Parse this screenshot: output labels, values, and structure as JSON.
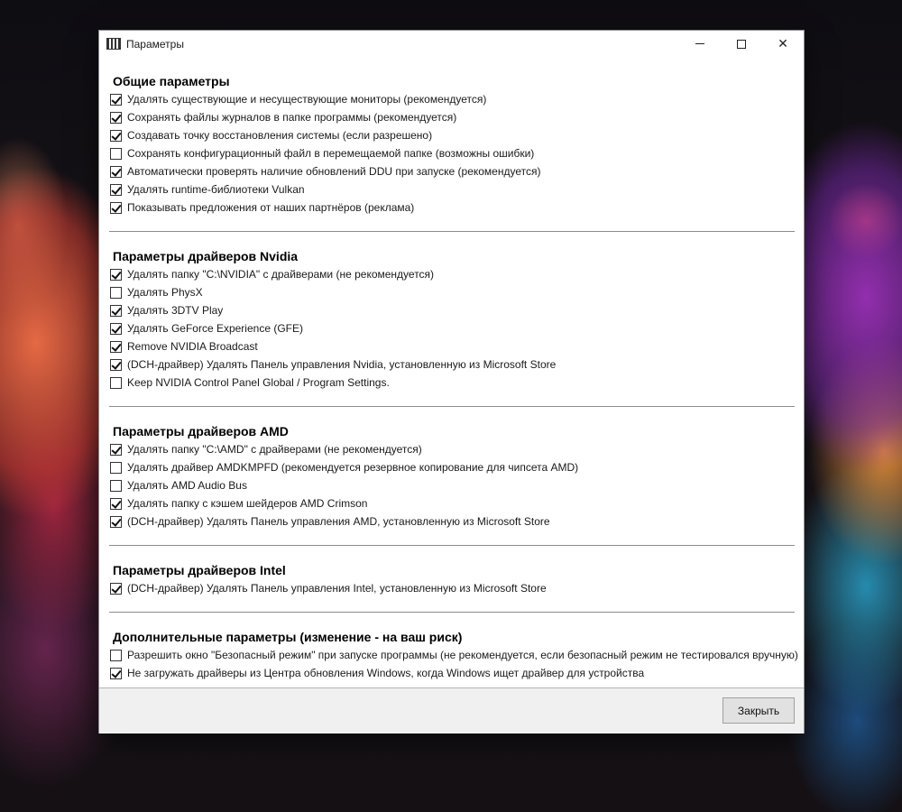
{
  "window": {
    "title": "Параметры"
  },
  "sections": [
    {
      "title": "Общие параметры",
      "options": [
        {
          "label": "Удалять существующие и несуществующие мониторы (рекомендуется)",
          "checked": true
        },
        {
          "label": "Сохранять файлы журналов в папке программы (рекомендуется)",
          "checked": true
        },
        {
          "label": "Создавать точку восстановления системы (если разрешено)",
          "checked": true
        },
        {
          "label": "Сохранять конфигурационный файл в перемещаемой папке (возможны ошибки)",
          "checked": false
        },
        {
          "label": "Автоматически проверять наличие обновлений DDU при запуске (рекомендуется)",
          "checked": true
        },
        {
          "label": "Удалять runtime-библиотеки Vulkan",
          "checked": true
        },
        {
          "label": "Показывать предложения от наших партнёров (реклама)",
          "checked": true
        }
      ]
    },
    {
      "title": "Параметры драйверов Nvidia",
      "options": [
        {
          "label": "Удалять папку \"C:\\NVIDIA\" с драйверами (не рекомендуется)",
          "checked": true
        },
        {
          "label": "Удалять PhysX",
          "checked": false
        },
        {
          "label": "Удалять 3DTV Play",
          "checked": true
        },
        {
          "label": "Удалять GeForce Experience (GFE)",
          "checked": true
        },
        {
          "label": "Remove NVIDIA Broadcast",
          "checked": true
        },
        {
          "label": "(DCH-драйвер) Удалять Панель управления Nvidia, установленную из Microsoft Store",
          "checked": true
        },
        {
          "label": "Keep NVIDIA Control Panel Global / Program Settings.",
          "checked": false
        }
      ]
    },
    {
      "title": "Параметры драйверов AMD",
      "options": [
        {
          "label": "Удалять папку \"C:\\AMD\" с драйверами (не рекомендуется)",
          "checked": true
        },
        {
          "label": "Удалять драйвер AMDKMPFD (рекомендуется резервное копирование для чипсета AMD)",
          "checked": false
        },
        {
          "label": "Удалять AMD Audio Bus",
          "checked": false
        },
        {
          "label": "Удалять папку с кэшем шейдеров AMD Crimson",
          "checked": true
        },
        {
          "label": "(DCH-драйвер) Удалять Панель управления AMD, установленную из Microsoft Store",
          "checked": true
        }
      ]
    },
    {
      "title": "Параметры драйверов Intel",
      "options": [
        {
          "label": "(DCH-драйвер) Удалять Панель управления Intel, установленную из Microsoft Store",
          "checked": true
        }
      ]
    },
    {
      "title": "Дополнительные параметры (изменение - на ваш риск)",
      "options": [
        {
          "label": "Разрешить окно \"Безопасный режим\" при запуске программы (не рекомендуется, если безопасный режим не тестировался вручную)",
          "checked": false
        },
        {
          "label": "Не загружать драйверы из Центра обновления Windows, когда Windows ищет драйвер для устройства",
          "checked": true
        }
      ]
    }
  ],
  "footer": {
    "close_label": "Закрыть"
  }
}
